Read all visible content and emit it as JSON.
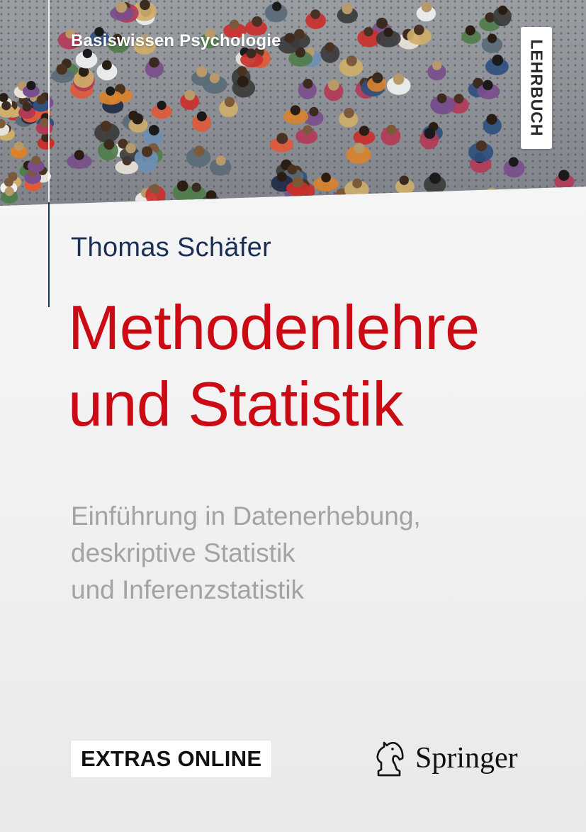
{
  "series": "Basiswissen Psychologie",
  "badge": "LEHRBUCH",
  "author": "Thomas Schäfer",
  "title_lines": [
    "Methodenlehre",
    "und Statistik"
  ],
  "subtitle_lines": [
    "Einführung in Datenerhebung,",
    "deskriptive Statistik",
    "und Inferenzstatistik"
  ],
  "extras": "EXTRAS ONLINE",
  "publisher": "Springer",
  "colors": {
    "title": "#cc0a14",
    "author": "#1a2f57",
    "subtitle": "#a3a3a6"
  }
}
